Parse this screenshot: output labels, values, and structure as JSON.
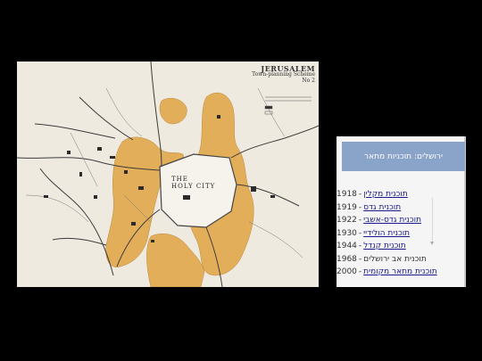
{
  "map": {
    "title": "JERUSALEM",
    "subtitle": "Town-planning Scheme",
    "scheme_no": "No 2",
    "city_label_1": "THE",
    "city_label_2": "HOLY CITY",
    "colors": {
      "parkland": "#e3ae5a",
      "road": "#3c3c3c",
      "background": "#eeeae0"
    }
  },
  "panel": {
    "header": "ירושלים: תוכניות מתאר",
    "items": [
      {
        "name": "תוכנית מקלין",
        "year": "1918",
        "linked": true
      },
      {
        "name": "תוכנית גדס",
        "year": "1919",
        "linked": true
      },
      {
        "name": "תוכנית גדס-אשבי",
        "year": "1922",
        "linked": true
      },
      {
        "name": "תוכנית הולידיי",
        "year": "1930",
        "linked": true
      },
      {
        "name": "תוכנית קנדל",
        "year": "1944",
        "linked": true
      },
      {
        "name": "תוכנית אב ירושלים",
        "year": "1968",
        "linked": false
      },
      {
        "name": "תוכנית מתאר מקומית",
        "year": "2000",
        "linked": true
      }
    ]
  }
}
